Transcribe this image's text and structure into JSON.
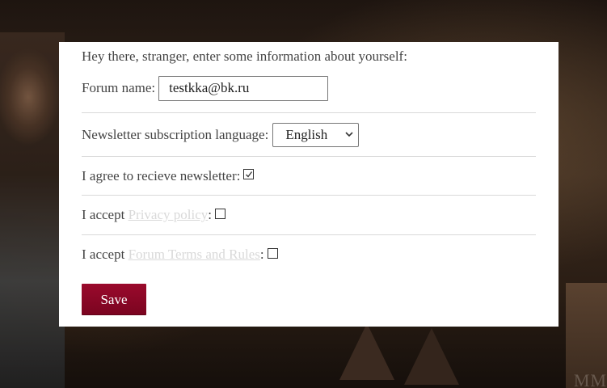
{
  "form": {
    "intro": "Hey there, stranger, enter some information about yourself:",
    "forum_name_label": "Forum name:",
    "forum_name_value": "testkka@bk.ru",
    "language_label": "Newsletter subscription language:",
    "language_selected": "English",
    "newsletter_label": "I agree to recieve newsletter:",
    "newsletter_checked": true,
    "privacy_prefix": "I accept ",
    "privacy_link": "Privacy policy",
    "privacy_suffix": ":",
    "privacy_checked": false,
    "terms_prefix": "I accept ",
    "terms_link": "Forum Terms and Rules",
    "terms_suffix": ":",
    "terms_checked": false,
    "save_label": "Save"
  },
  "background": {
    "watermark": "MM"
  },
  "colors": {
    "button": "#8a0826",
    "link": "#d9d9d9",
    "text": "#444444"
  }
}
